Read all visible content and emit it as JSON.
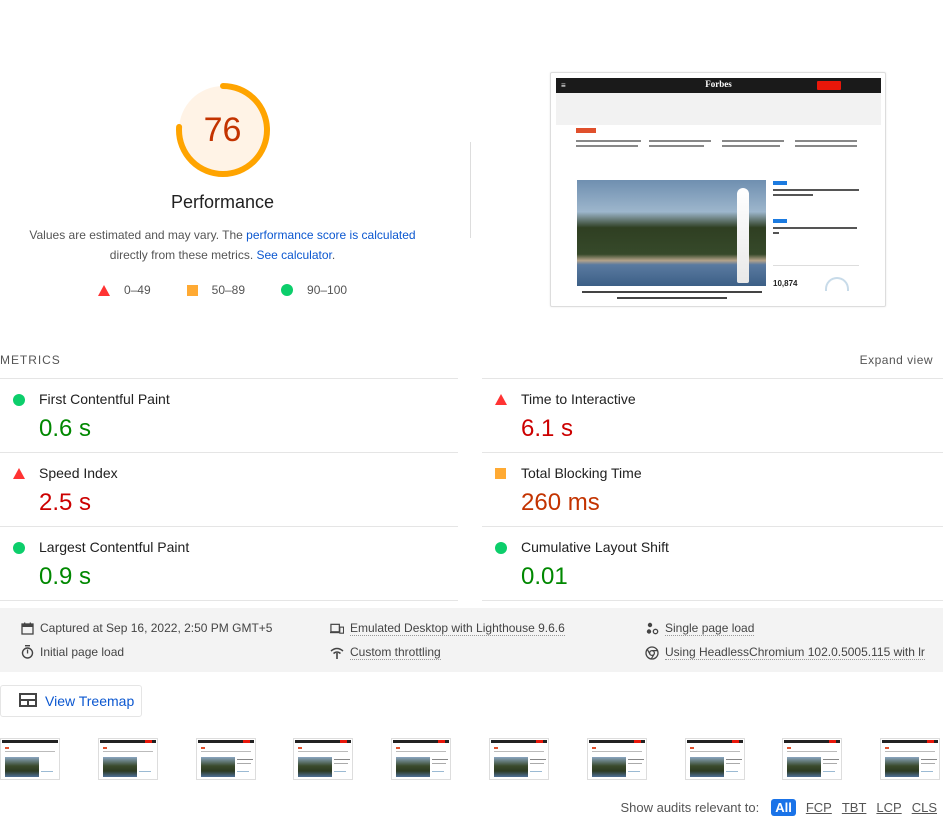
{
  "gauge": {
    "score": "76",
    "score_fraction": 0.76,
    "title": "Performance",
    "desc_prefix": "Values are estimated and may vary. The ",
    "desc_link": "performance score is calculated",
    "desc_mid": " directly from these metrics. ",
    "desc_link2": "See calculator",
    "desc_suffix": ".",
    "colors": {
      "ring": "#ffa400",
      "fill": "#fff3e6",
      "text": "#c33300"
    }
  },
  "scale": [
    {
      "icon": "fail-triangle-icon",
      "label": "0–49"
    },
    {
      "icon": "average-square-icon",
      "label": "50–89"
    },
    {
      "icon": "pass-circle-icon",
      "label": "90–100"
    }
  ],
  "final_screenshot": {
    "site_logo": "Forbes",
    "readers_count": "10,874"
  },
  "metrics": {
    "header": "METRICS",
    "expand_label": "Expand view",
    "items": [
      {
        "name": "First Contentful Paint",
        "value": "0.6 s",
        "rating": "pass"
      },
      {
        "name": "Time to Interactive",
        "value": "6.1 s",
        "rating": "fail"
      },
      {
        "name": "Speed Index",
        "value": "2.5 s",
        "rating": "fail"
      },
      {
        "name": "Total Blocking Time",
        "value": "260 ms",
        "rating": "average"
      },
      {
        "name": "Largest Contentful Paint",
        "value": "0.9 s",
        "rating": "pass"
      },
      {
        "name": "Cumulative Layout Shift",
        "value": "0.01",
        "rating": "pass"
      }
    ]
  },
  "runtime": {
    "captured": "Captured at Sep 16, 2022, 2:50 PM GMT+5",
    "initial_load": "Initial page load",
    "emulated": "Emulated Desktop with Lighthouse 9.6.6",
    "throttling": "Custom throttling",
    "single_load": "Single page load",
    "browser": "Using HeadlessChromium 102.0.5005.115 with lr"
  },
  "treemap": {
    "label": "View Treemap"
  },
  "filmstrip": {
    "frame_count": 10
  },
  "filter": {
    "label": "Show audits relevant to:",
    "chips": [
      "All",
      "FCP",
      "TBT",
      "LCP",
      "CLS"
    ],
    "active": "All"
  }
}
